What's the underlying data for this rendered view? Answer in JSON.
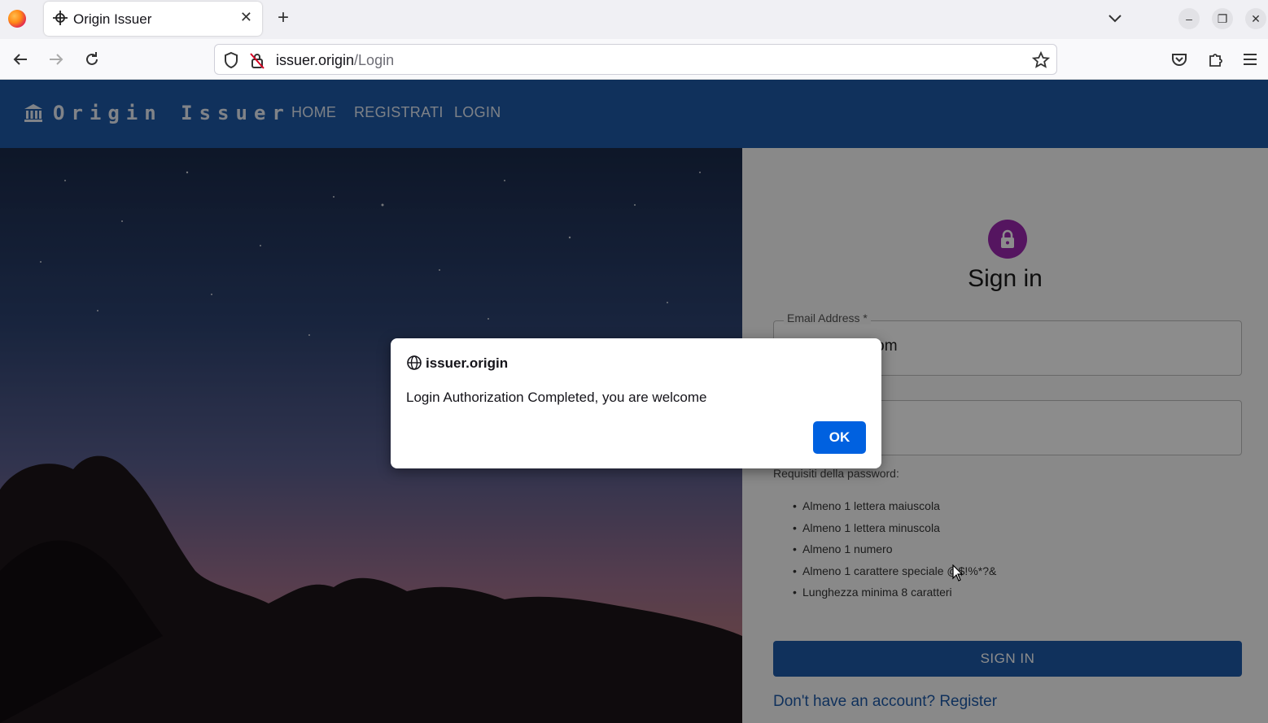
{
  "browser": {
    "tab_title": "Origin Issuer",
    "tab_close": "✕",
    "new_tab": "+",
    "url_host": "issuer.origin",
    "url_path": "/Login",
    "window_buttons": [
      "–",
      "❐",
      "✕"
    ]
  },
  "app": {
    "brand": "Origin Issuer",
    "nav": [
      "HOME",
      "REGISTRATI",
      "LOGIN"
    ]
  },
  "signin": {
    "title": "Sign in",
    "email_label": "Email Address *",
    "email_value": "a99@gmail.com",
    "password_requirements_title": "Requisiti della password:",
    "requirements": [
      "Almeno 1 lettera maiuscola",
      "Almeno 1 lettera minuscola",
      "Almeno 1 numero",
      "Almeno 1 carattere speciale @$!%*?&",
      "Lunghezza minima 8 caratteri"
    ],
    "submit": "SIGN IN",
    "register_link": "Don't have an account? Register"
  },
  "dialog": {
    "origin": "issuer.origin",
    "message": "Login Authorization Completed, you are welcome",
    "ok": "OK"
  },
  "colors": {
    "appbar": "#1e5aa8",
    "lock": "#9c27b0",
    "ok_button": "#0061e0"
  }
}
